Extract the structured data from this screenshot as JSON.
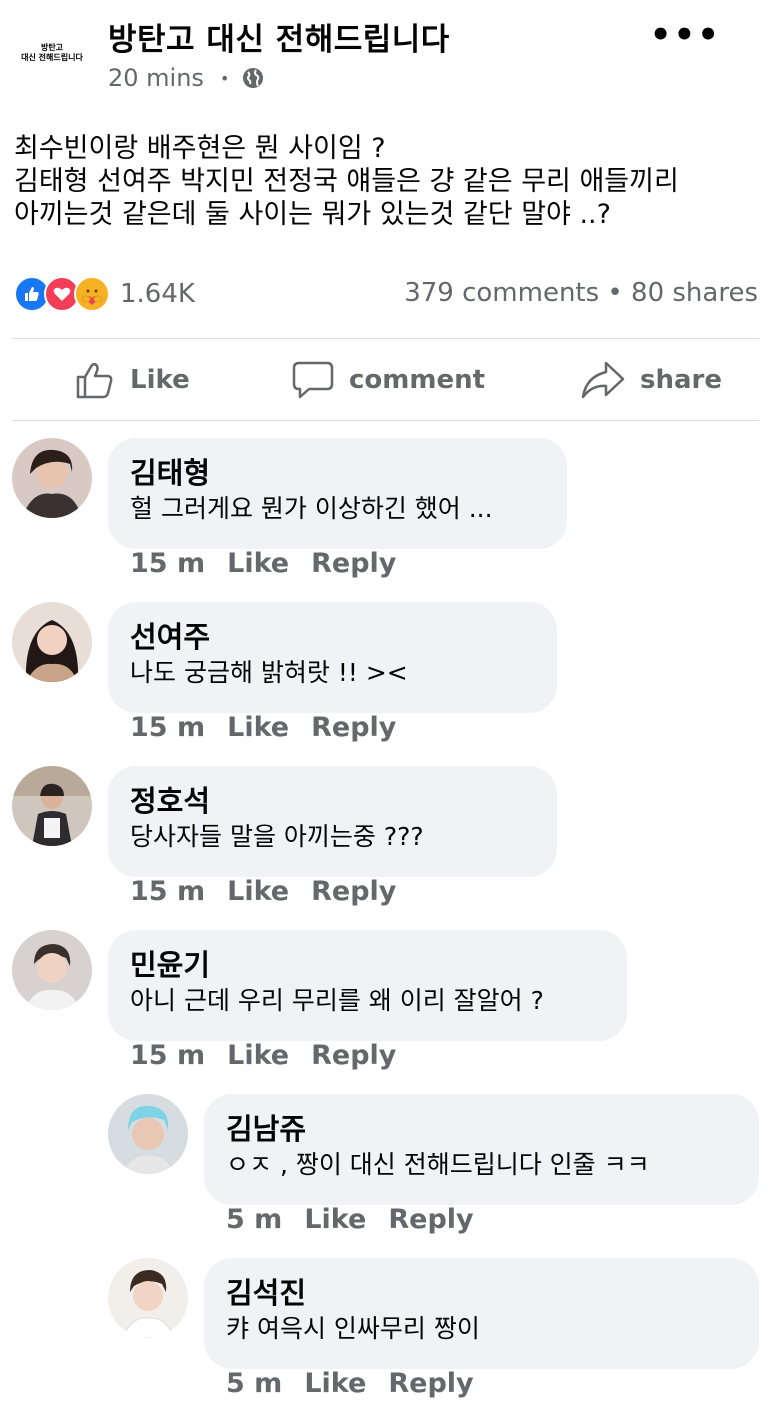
{
  "post": {
    "page_name": "방탄고 대신 전해드립니다",
    "logo_lines": [
      "방탄고",
      "대신 전해드립니다"
    ],
    "time": "20 mins",
    "text_lines": [
      "최수빈이랑 배주현은 뭔 사이임 ?",
      "김태형 선여주 박지민 전정국 얘들은 걍 같은 무리 애들끼리",
      "아끼는것 같은데 둘 사이는 뭐가 있는것 같단 말야 ..?"
    ],
    "reaction_count": "1.64K",
    "stats": "379 comments • 80 shares"
  },
  "actions": {
    "like": "Like",
    "comment": "comment",
    "share": "share"
  },
  "comments": [
    {
      "name": "김태형",
      "text": "헐 그러게요 뭔가 이상하긴 했어 ...",
      "time": "15 m",
      "like": "Like",
      "reply": "Reply"
    },
    {
      "name": "선여주",
      "text": "나도 궁금해 밝혀랏 !! ><",
      "time": "15 m",
      "like": "Like",
      "reply": "Reply"
    },
    {
      "name": "정호석",
      "text": "당사자들 말을 아끼는중 ???",
      "time": "15 m",
      "like": "Like",
      "reply": "Reply"
    },
    {
      "name": "민윤기",
      "text": "아니 근데 우리 무리를 왜 이리 잘알어 ?",
      "time": "15 m",
      "like": "Like",
      "reply": "Reply"
    },
    {
      "name": "김남쥬",
      "text": "ㅇㅈ , 짱이 대신 전해드립니다 인줄 ㅋㅋ",
      "time": "5 m",
      "like": "Like",
      "reply": "Reply"
    },
    {
      "name": "김석진",
      "text": "캬 여윽시 인싸무리 짱이",
      "time": "5 m",
      "like": "Like",
      "reply": "Reply"
    }
  ],
  "colors": {
    "like_blue": "#1877f2",
    "love_red": "#f33e58",
    "care_yellow": "#f7b125",
    "bubble_gray": "#f0f2f5",
    "meta_gray": "#65676b"
  },
  "icons": {
    "privacy": "globe-icon",
    "more": "ellipsis-icon",
    "like": "thumbs-up-icon",
    "comment": "speech-bubble-icon",
    "share": "share-arrow-icon"
  }
}
